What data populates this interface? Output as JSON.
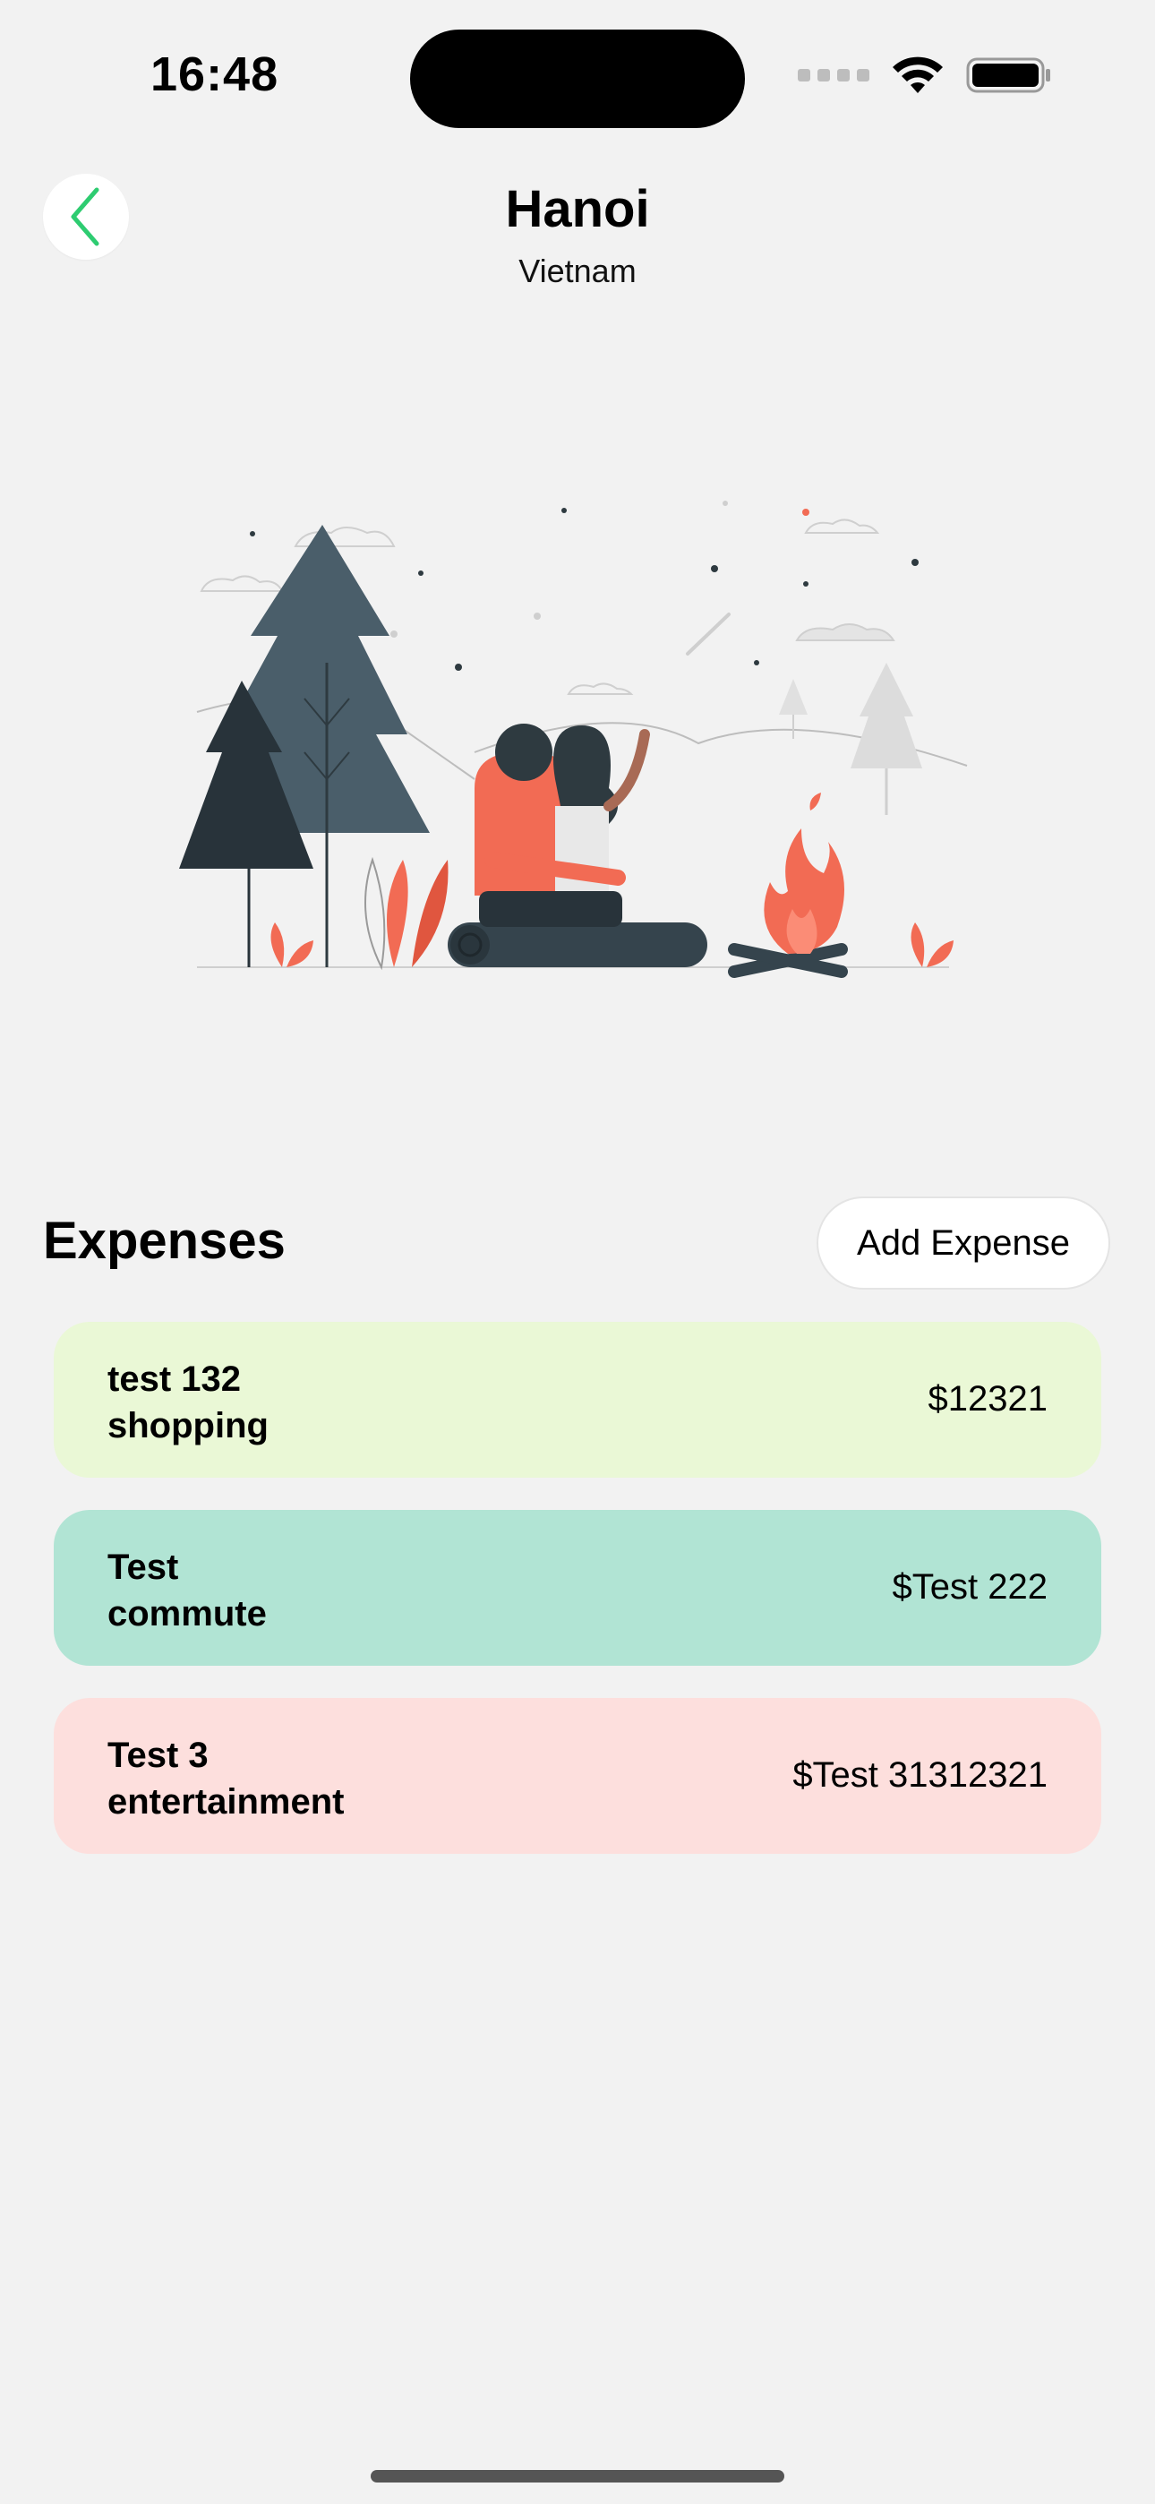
{
  "status_bar": {
    "time": "16:48"
  },
  "header": {
    "title": "Hanoi",
    "subtitle": "Vietnam",
    "back_icon": "chevron-left-icon",
    "back_icon_color": "#2ecc71"
  },
  "expenses": {
    "title": "Expenses",
    "add_button_label": "Add Expense",
    "items": [
      {
        "name": "test 132",
        "category": "shopping",
        "amount": "$12321",
        "color": "#eaf8d6"
      },
      {
        "name": "Test",
        "category": "commute",
        "amount": "$Test 222",
        "color": "#b1e4d4"
      },
      {
        "name": "Test 3",
        "category": "entertainment",
        "amount": "$Test 31312321",
        "color": "#fddfdd"
      }
    ]
  }
}
